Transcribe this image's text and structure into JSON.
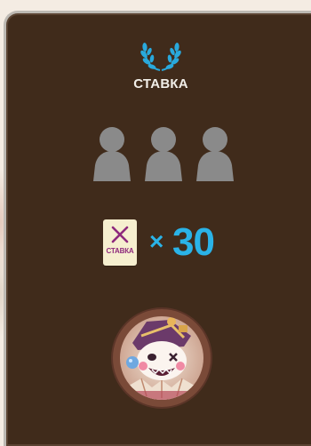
{
  "panel": {
    "title": "СТАВКА"
  },
  "players": {
    "slots": [
      "empty-player-slot",
      "empty-player-slot",
      "empty-player-slot"
    ]
  },
  "bet": {
    "ticket_label": "СТАВКА",
    "multiplier_symbol": "×",
    "amount": "30"
  },
  "icons": {
    "laurel": "laurel-wreath-icon",
    "player": "person-silhouette-icon",
    "ticket_mark": "cross-icon",
    "character": "clown-character-avatar"
  },
  "colors": {
    "panel_bg": "#402b1b",
    "accent_blue": "#2ab3e8",
    "ticket_bg": "#f6efcf",
    "ticket_text": "#8e2a7c",
    "silhouette": "#8a8a8a"
  }
}
